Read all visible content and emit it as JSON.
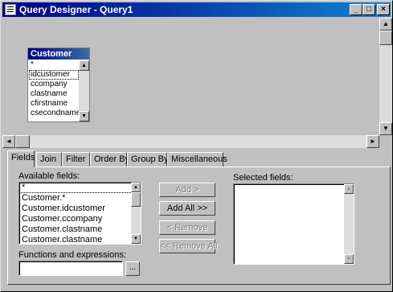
{
  "window": {
    "title": "Query Designer - Query1",
    "minimize_glyph": "_",
    "maximize_glyph": "□",
    "close_glyph": "×"
  },
  "table": {
    "name": "Customer",
    "fields": [
      "*",
      "idcustomer",
      "ccompany",
      "clastname",
      "cfirstname",
      "csecondname"
    ]
  },
  "tabs": [
    "Fields",
    "Join",
    "Filter",
    "Order By",
    "Group By",
    "Miscellaneous"
  ],
  "fields_tab": {
    "available_label": "Available fields:",
    "available_fields": [
      "*",
      "Customer.*",
      "Customer.idcustomer",
      "Customer.ccompany",
      "Customer.clastname",
      "Customer.clastname"
    ],
    "selected_label": "Selected fields:",
    "functions_label": "Functions and expressions:",
    "functions_value": "",
    "browse_label": "...",
    "buttons": {
      "add": "Add >",
      "add_all": "Add All >>",
      "remove": "< Remove",
      "remove_all": "<< Remove All"
    }
  },
  "icons": {
    "arrow_up": "▲",
    "arrow_down": "▼",
    "arrow_left": "◄",
    "arrow_right": "►"
  }
}
